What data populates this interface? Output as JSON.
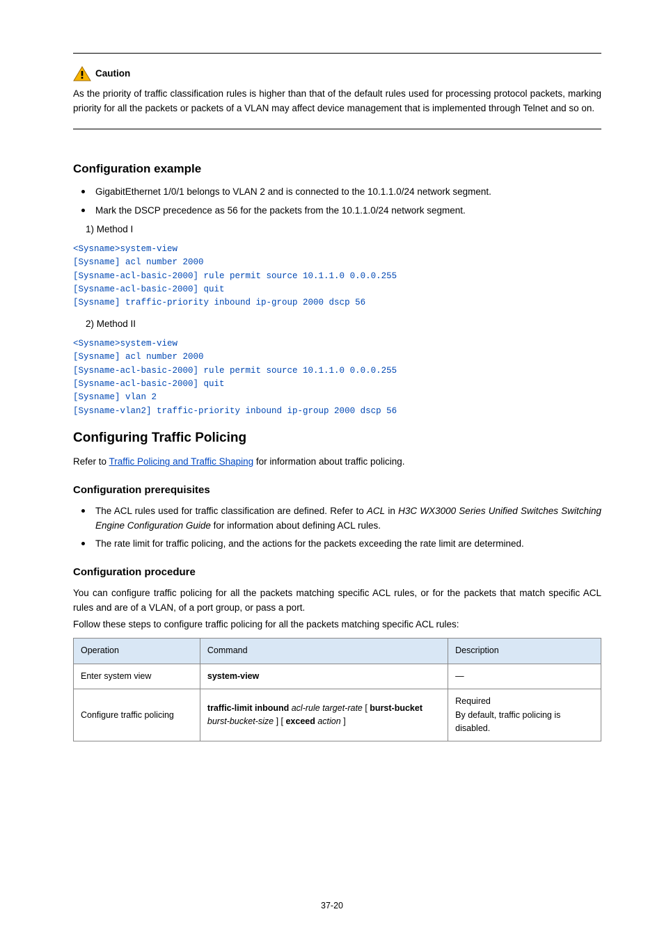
{
  "caution": {
    "label": "Caution",
    "text": "As the priority of traffic classification rules is higher than that of the default rules used for processing protocol packets, marking priority for all the packets or packets of a VLAN may affect device management that is implemented through Telnet and so on."
  },
  "example": {
    "title": "Configuration example",
    "bullets": [
      "GigabitEthernet 1/0/1 belongs to VLAN 2 and is connected to the 10.1.1.0/24 network segment.",
      "Mark the DSCP precedence as 56 for the packets from the 10.1.1.0/24 network segment."
    ],
    "m1": {
      "label": "1)    Method I",
      "code": "<Sysname>system-view\n[Sysname] acl number 2000\n[Sysname-acl-basic-2000] rule permit source 10.1.1.0 0.0.0.255\n[Sysname-acl-basic-2000] quit\n[Sysname] traffic-priority inbound ip-group 2000 dscp 56"
    },
    "m2": {
      "label": "2)    Method II",
      "code": "<Sysname>system-view\n[Sysname] acl number 2000\n[Sysname-acl-basic-2000] rule permit source 10.1.1.0 0.0.0.255\n[Sysname-acl-basic-2000] quit\n[Sysname] vlan 2\n[Sysname-vlan2] traffic-priority inbound ip-group 2000 dscp 56"
    }
  },
  "policing": {
    "title": "Configuring Traffic Policing",
    "intro_pre": "Refer to ",
    "intro_link": "Traffic Policing and Traffic Shaping",
    "intro_post": " for information about traffic policing.",
    "prereq_title": "Configuration prerequisites",
    "prereq_items": {
      "acl_pre": "The ACL rules used for traffic classification are defined. Refer to ",
      "acl_ref": "ACL",
      "acl_mid": " in ",
      "acl_manual": "H3C WX3000 Series Unified Switches Switching Engine Configuration Guide",
      "acl_post": " for information about defining ACL rules.",
      "rate": "The rate limit for traffic policing, and the actions for the packets exceeding the rate limit are determined."
    },
    "proc_title": "Configuration procedure",
    "proc_p1": "You can configure traffic policing for all the packets matching specific ACL rules, or for the packets that match specific ACL rules and are of a VLAN, of a port group, or pass a port.",
    "proc_p2": "Follow these steps to configure traffic policing for all the packets matching specific ACL rules:"
  },
  "table": {
    "headers": {
      "op": "Operation",
      "cmd": "Command",
      "desc": "Description"
    },
    "rows": {
      "r1": {
        "op": "Enter system view",
        "cmd": "system-view",
        "desc": "—"
      },
      "r2": {
        "op": "Configure traffic policing",
        "cmd_pre": "traffic-limit inbound ",
        "acl": "acl-rule",
        "tr": " target-rate",
        "lb": " [ ",
        "bb": "burst-bucket burst-bucket-size",
        "mb": " ] [ ",
        "ea": "exceed action",
        "rb": " ]",
        "desc1": "Required",
        "desc2": "By default, traffic policing is disabled."
      }
    }
  },
  "page_num": "37-20"
}
